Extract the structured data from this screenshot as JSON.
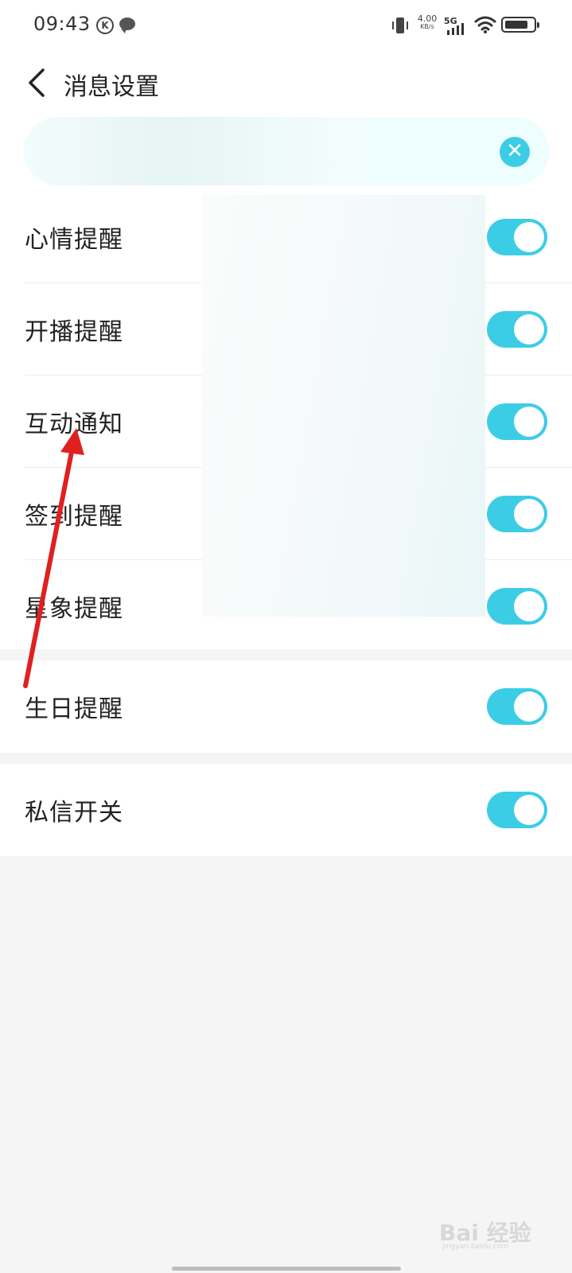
{
  "status_bar": {
    "time": "09:43",
    "k_badge": "K",
    "speed_value": "4.00",
    "speed_unit": "KB/s",
    "network": "5G"
  },
  "header": {
    "title": "消息设置"
  },
  "banner": {
    "close_symbol": "✕"
  },
  "settings": {
    "items": [
      {
        "label": "心情提醒",
        "enabled": true
      },
      {
        "label": "开播提醒",
        "enabled": true
      },
      {
        "label": "互动通知",
        "enabled": true
      },
      {
        "label": "签到提醒",
        "enabled": true
      },
      {
        "label": "星象提醒",
        "enabled": true
      },
      {
        "label": "生日提醒",
        "enabled": true
      },
      {
        "label": "私信开关",
        "enabled": true
      }
    ]
  },
  "colors": {
    "accent": "#3ccde6",
    "annotation_arrow": "#e02020"
  },
  "watermark": {
    "text": "Bai 经验",
    "sub": "jingyan.baidu.com"
  }
}
